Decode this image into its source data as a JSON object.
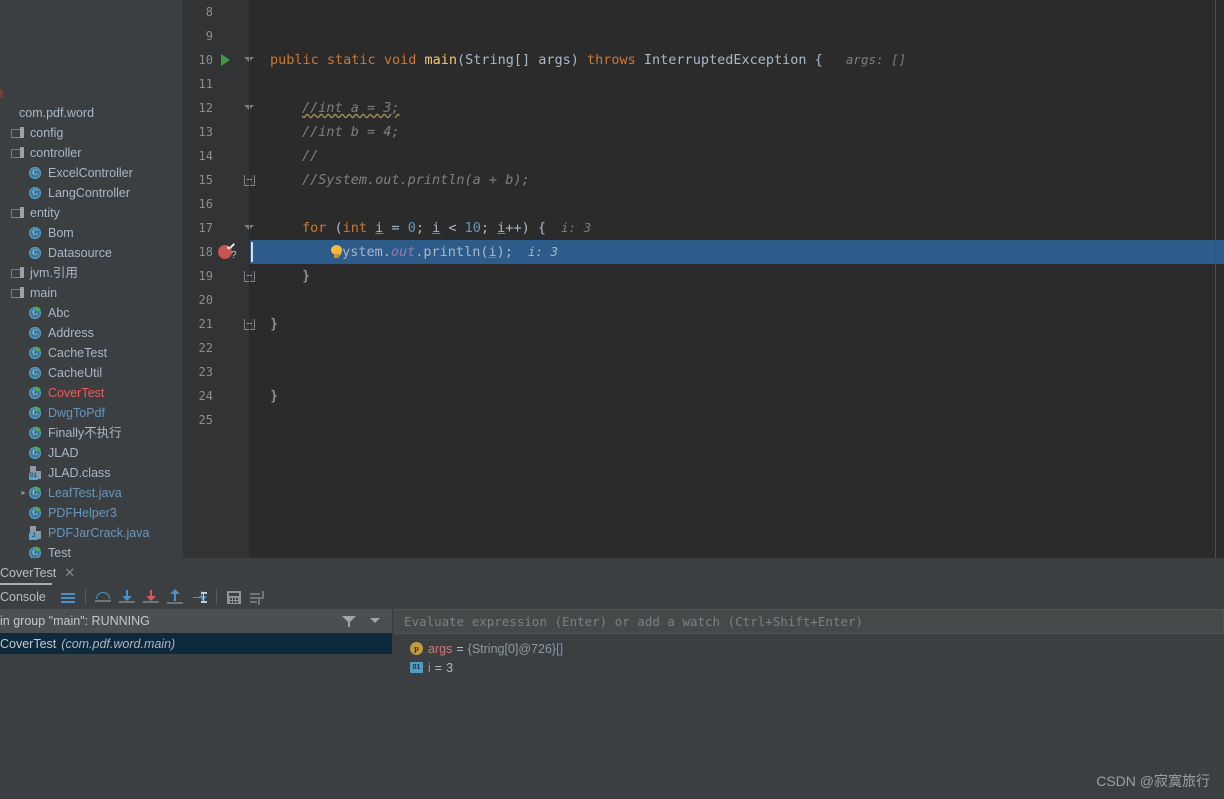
{
  "project_tree": {
    "root_label": "com.pdf.word",
    "items": [
      {
        "label": "com.pdf.word",
        "icon": "package-icon",
        "indent": 0,
        "type": "root",
        "color": "grey",
        "arrow": ""
      },
      {
        "label": "config",
        "icon": "folder-icon",
        "indent": 1,
        "type": "folder",
        "color": "grey",
        "arrow": ""
      },
      {
        "label": "controller",
        "icon": "folder-icon",
        "indent": 1,
        "type": "folder",
        "color": "grey",
        "arrow": ""
      },
      {
        "label": "ExcelController",
        "icon": "class-icon",
        "indent": 2,
        "type": "class",
        "color": "grey",
        "arrow": ""
      },
      {
        "label": "LangController",
        "icon": "class-icon",
        "indent": 2,
        "type": "class",
        "color": "grey",
        "arrow": ""
      },
      {
        "label": "entity",
        "icon": "folder-icon",
        "indent": 1,
        "type": "folder",
        "color": "grey",
        "arrow": ""
      },
      {
        "label": "Bom",
        "icon": "class-icon",
        "indent": 2,
        "type": "class",
        "color": "grey",
        "arrow": ""
      },
      {
        "label": "Datasource",
        "icon": "class-icon",
        "indent": 2,
        "type": "class",
        "color": "grey",
        "arrow": ""
      },
      {
        "label": "jvm.引用",
        "icon": "folder-icon",
        "indent": 1,
        "type": "folder",
        "color": "grey",
        "arrow": ""
      },
      {
        "label": "main",
        "icon": "folder-icon",
        "indent": 1,
        "type": "folder",
        "color": "grey",
        "arrow": ""
      },
      {
        "label": "Abc",
        "icon": "runnable-class-icon",
        "indent": 2,
        "type": "runclass",
        "color": "grey",
        "arrow": ""
      },
      {
        "label": "Address",
        "icon": "class-icon",
        "indent": 2,
        "type": "class",
        "color": "grey",
        "arrow": ""
      },
      {
        "label": "CacheTest",
        "icon": "runnable-class-icon",
        "indent": 2,
        "type": "runclass",
        "color": "grey",
        "arrow": ""
      },
      {
        "label": "CacheUtil",
        "icon": "class-icon",
        "indent": 2,
        "type": "class",
        "color": "grey",
        "arrow": ""
      },
      {
        "label": "CoverTest",
        "icon": "runnable-class-icon",
        "indent": 2,
        "type": "runclass",
        "color": "red",
        "arrow": ""
      },
      {
        "label": "DwgToPdf",
        "icon": "runnable-class-icon",
        "indent": 2,
        "type": "runclass",
        "color": "blue",
        "arrow": ""
      },
      {
        "label": "Finally不执行",
        "icon": "runnable-class-icon",
        "indent": 2,
        "type": "runclass",
        "color": "grey",
        "arrow": ""
      },
      {
        "label": "JLAD",
        "icon": "runnable-class-icon",
        "indent": 2,
        "type": "runclass",
        "color": "grey",
        "arrow": ""
      },
      {
        "label": "JLAD.class",
        "icon": "compiled-class-icon",
        "indent": 2,
        "type": "file",
        "color": "grey",
        "arrow": ""
      },
      {
        "label": "LeafTest.java",
        "icon": "runnable-class-icon",
        "indent": 2,
        "type": "runclass",
        "color": "blue",
        "arrow": "▸"
      },
      {
        "label": "PDFHelper3",
        "icon": "runnable-class-icon",
        "indent": 2,
        "type": "runclass",
        "color": "blue",
        "arrow": ""
      },
      {
        "label": "PDFJarCrack.java",
        "icon": "compiled-class-icon",
        "indent": 2,
        "type": "file",
        "color": "blue",
        "arrow": ""
      },
      {
        "label": "Test",
        "icon": "runnable-class-icon",
        "indent": 2,
        "type": "runclass",
        "color": "grey",
        "arrow": ""
      }
    ]
  },
  "editor": {
    "first_line_number": 8,
    "lines": [
      {
        "n": 8,
        "segments": []
      },
      {
        "n": 9,
        "segments": []
      },
      {
        "n": 10,
        "segments": [
          {
            "t": "public ",
            "c": "kw"
          },
          {
            "t": "static ",
            "c": "kw"
          },
          {
            "t": "void ",
            "c": "kw"
          },
          {
            "t": "main",
            "c": "fn"
          },
          {
            "t": "(String[] args) ",
            "c": "txt"
          },
          {
            "t": "throws ",
            "c": "kw"
          },
          {
            "t": "InterruptedException { ",
            "c": "txt"
          },
          {
            "t": "  args: []",
            "c": "hint"
          }
        ],
        "indent": 0,
        "gutter": "run-arrow",
        "fold": "tri"
      },
      {
        "n": 11,
        "segments": []
      },
      {
        "n": 12,
        "segments": [
          {
            "t": "//int a = 3;",
            "c": "cmt",
            "squiggle": true
          }
        ],
        "indent": 1,
        "fold": "tri"
      },
      {
        "n": 13,
        "segments": [
          {
            "t": "//int b = 4;",
            "c": "cmt"
          }
        ],
        "indent": 1
      },
      {
        "n": 14,
        "segments": [
          {
            "t": "//",
            "c": "cmt"
          }
        ],
        "indent": 1
      },
      {
        "n": 15,
        "segments": [
          {
            "t": "//System.out.println(a + b);",
            "c": "cmt"
          }
        ],
        "indent": 1,
        "fold": "box-end"
      },
      {
        "n": 16,
        "segments": []
      },
      {
        "n": 17,
        "segments": [
          {
            "t": "for ",
            "c": "kw"
          },
          {
            "t": "(",
            "c": "txt"
          },
          {
            "t": "int ",
            "c": "kw"
          },
          {
            "t": "i",
            "c": "txt",
            "ul": true
          },
          {
            "t": " = ",
            "c": "txt"
          },
          {
            "t": "0",
            "c": "num"
          },
          {
            "t": "; ",
            "c": "txt"
          },
          {
            "t": "i",
            "c": "txt",
            "ul": true
          },
          {
            "t": " < ",
            "c": "txt"
          },
          {
            "t": "10",
            "c": "num"
          },
          {
            "t": "; ",
            "c": "txt"
          },
          {
            "t": "i",
            "c": "txt",
            "ul": true
          },
          {
            "t": "++) {",
            "c": "txt"
          },
          {
            "t": "  i: 3",
            "c": "hint"
          }
        ],
        "indent": 1,
        "fold": "tri"
      },
      {
        "n": 18,
        "segments": [
          {
            "t": "System.",
            "c": "txt"
          },
          {
            "t": "out",
            "c": "fld"
          },
          {
            "t": ".println(",
            "c": "txt"
          },
          {
            "t": "i",
            "c": "txt",
            "ul": true
          },
          {
            "t": ");",
            "c": "txt"
          },
          {
            "t": "  i: 3",
            "c": "hint"
          }
        ],
        "indent": 2,
        "highlight": true,
        "gutter": "breakpoint-verified",
        "bulb": true
      },
      {
        "n": 19,
        "segments": [
          {
            "t": "}",
            "c": "txt"
          }
        ],
        "indent": 1,
        "fold": "box-end"
      },
      {
        "n": 20,
        "segments": []
      },
      {
        "n": 21,
        "segments": [
          {
            "t": "}",
            "c": "txt"
          }
        ],
        "indent": 0,
        "fold": "box-end"
      },
      {
        "n": 22,
        "segments": []
      },
      {
        "n": 23,
        "segments": []
      },
      {
        "n": 24,
        "segments": [
          {
            "t": "}",
            "c": "txt"
          }
        ],
        "indent": 0
      },
      {
        "n": 25,
        "segments": []
      }
    ]
  },
  "debug": {
    "tab_label": "CoverTest",
    "tab_close": "✕",
    "console_label": "Console",
    "toolbar_icons": [
      {
        "name": "show-execution-point-icon",
        "kind": "menu"
      },
      {
        "name": "step-over-icon",
        "kind": "stepover"
      },
      {
        "name": "step-into-icon",
        "kind": "down-blue"
      },
      {
        "name": "force-step-into-icon",
        "kind": "down-red"
      },
      {
        "name": "step-out-icon",
        "kind": "up-blue"
      },
      {
        "name": "run-to-cursor-icon",
        "kind": "tocursor"
      },
      {
        "name": "evaluate-expression-icon",
        "kind": "calc"
      },
      {
        "name": "layout-settings-icon",
        "kind": "layout"
      }
    ],
    "thread_status": "in group \"main\": RUNNING",
    "frame": {
      "method": "CoverTest",
      "location": "(com.pdf.word.main)"
    },
    "evaluate_placeholder": "Evaluate expression (Enter) or add a watch (Ctrl+Shift+Enter)",
    "variables": [
      {
        "icon_label": "p",
        "icon_kind": "param",
        "name": "args",
        "eq": "=",
        "value": "{String[0]@726}",
        "extra": "[]"
      },
      {
        "icon_label": "01",
        "icon_kind": "prim",
        "name": "i",
        "eq": "=",
        "value": "3",
        "extra": ""
      }
    ]
  },
  "watermark": "CSDN @寂寞旅行",
  "colors": {
    "editor_bg": "#2b2b2b",
    "panel_bg": "#3c3f41",
    "gutter_bg": "#313335",
    "highlight_line": "#2e5c8a",
    "frame_selected": "#0d293e",
    "keyword": "#cc7832",
    "method": "#ffc66d",
    "number": "#6897bb",
    "comment": "#808080",
    "field": "#9876aa",
    "text": "#a9b7c6",
    "breakpoint": "#c75450",
    "run_green": "#3f9a42"
  }
}
